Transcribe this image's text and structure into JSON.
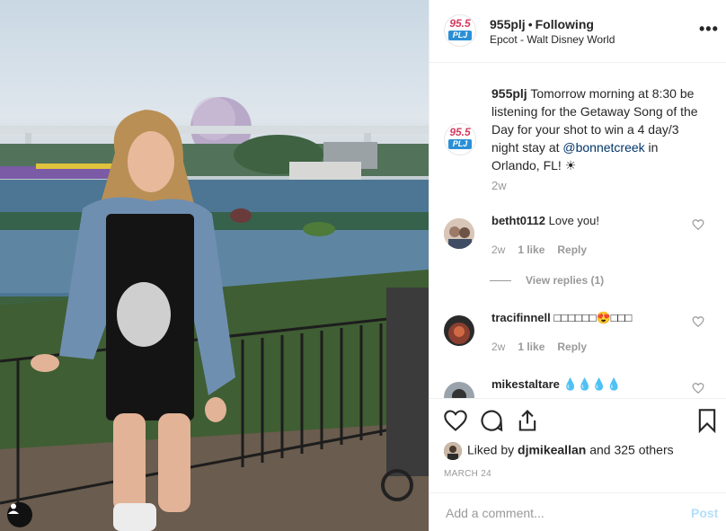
{
  "post": {
    "handle": "955plj",
    "separator": "•",
    "follow_status": "Following",
    "location": "Epcot - Walt Disney World",
    "more_label": "•••",
    "logo": {
      "line1": "95.5",
      "line2": "PLJ"
    }
  },
  "caption": {
    "handle": "955plj",
    "text_before": " Tomorrow morning at 8:30 be listening for the Getaway Song of the Day for your shot to win a 4 day/3 night stay at ",
    "mention": "@bonnetcreek",
    "text_after": " in Orlando, FL! ☀",
    "time": "2w"
  },
  "comments": [
    {
      "user": "betht0112",
      "text": "Love you!",
      "time": "2w",
      "likes": "1 like",
      "reply": "Reply",
      "view_replies": "View replies (1)"
    },
    {
      "user": "tracifinnell",
      "text": "□□□□□□😍□□□",
      "time": "2w",
      "likes": "1 like",
      "reply": "Reply"
    },
    {
      "user": "mikestaltare",
      "text": "💧💧💧💧"
    }
  ],
  "likes": {
    "prefix": "Liked by ",
    "user": "djmikeallan",
    "suffix": " and 325 others"
  },
  "date": "MARCH 24",
  "add_comment": {
    "placeholder": "Add a comment...",
    "post_label": "Post"
  },
  "colors": {
    "link": "#003569",
    "muted": "#999999",
    "post_disabled": "#b2dffc",
    "logo_pink": "#d63a5f",
    "logo_blue": "#2b8fd6"
  },
  "icons": [
    "heart-icon",
    "comment-icon",
    "share-icon",
    "bookmark-icon",
    "user-tag-icon",
    "more-options-icon"
  ]
}
